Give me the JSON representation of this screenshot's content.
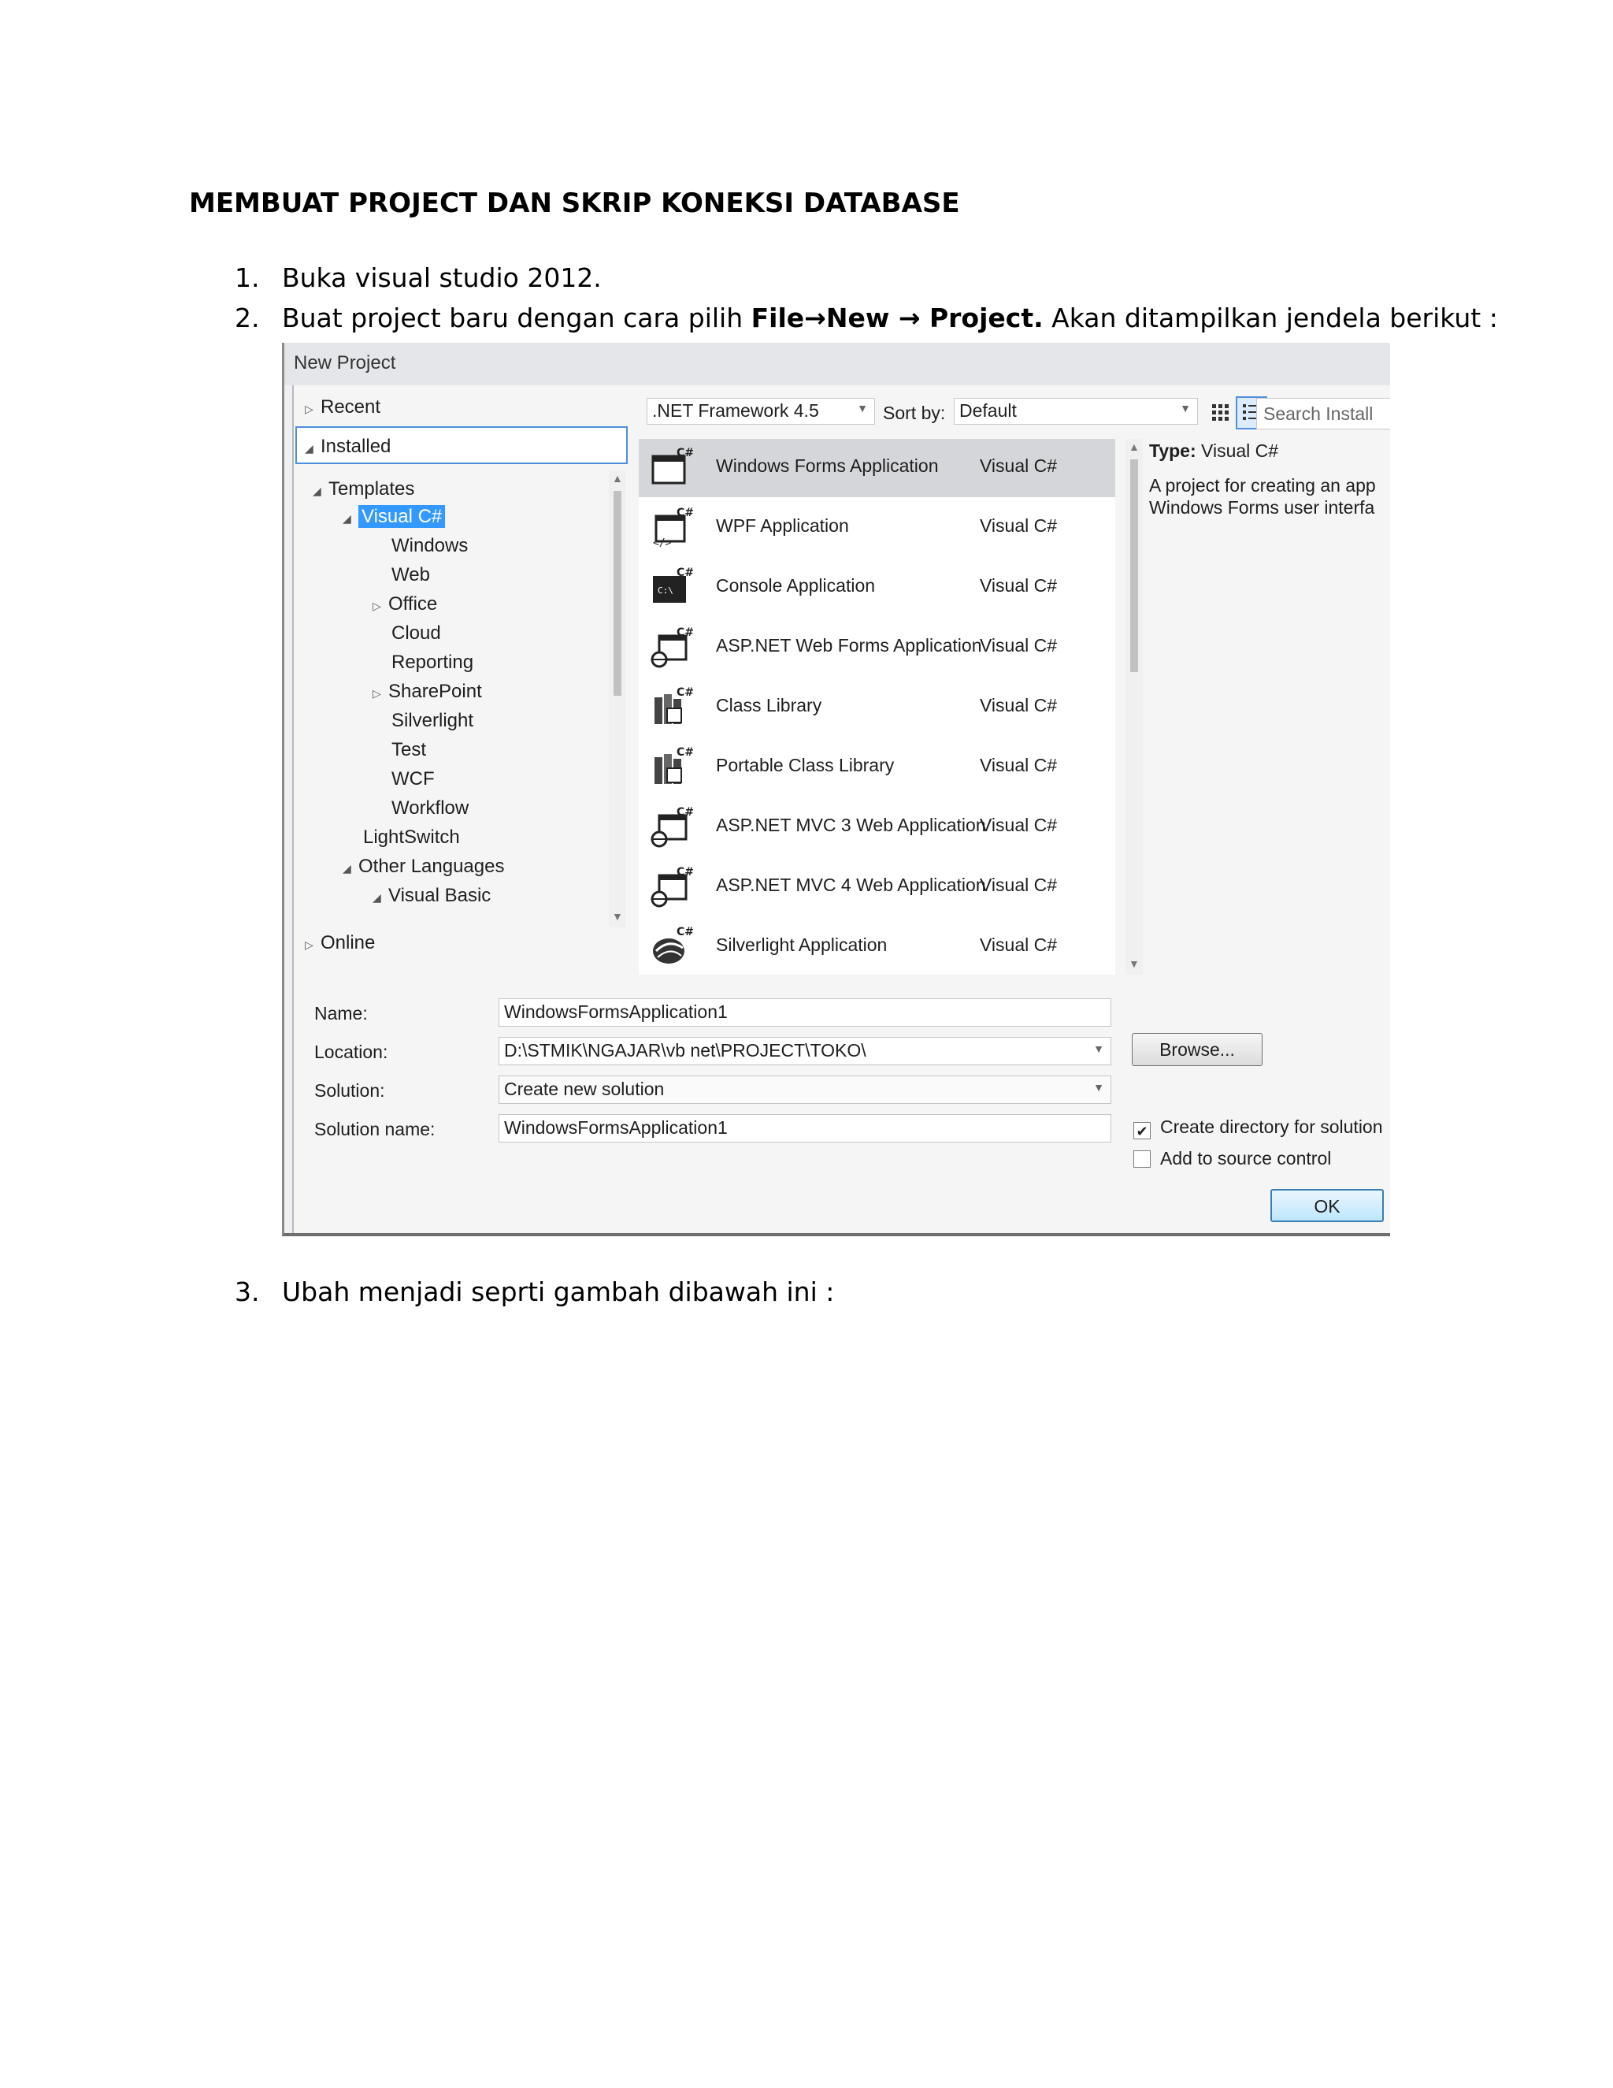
{
  "document": {
    "title": "MEMBUAT PROJECT DAN SKRIP KONEKSI DATABASE",
    "steps": [
      {
        "num": "1.",
        "text": "Buka visual studio 2012."
      },
      {
        "num": "2.",
        "pre": "Buat project baru dengan cara pilih ",
        "b1": "File",
        "arrow1": "→",
        "b2": "New",
        "arrow2": " → ",
        "b3": "Project.",
        "post": " Akan ditampilkan jendela berikut :"
      },
      {
        "num": "3.",
        "text": "Ubah menjadi seprti gambah dibawah ini :"
      }
    ]
  },
  "dialog": {
    "title": "New Project",
    "nav": {
      "recent": "Recent",
      "installed": "Installed",
      "templates": "Templates",
      "visual_csharp": "Visual C#",
      "children": [
        "Windows",
        "Web",
        "Office",
        "Cloud",
        "Reporting",
        "SharePoint",
        "Silverlight",
        "Test",
        "WCF",
        "Workflow"
      ],
      "lightswitch": "LightSwitch",
      "other_languages": "Other Languages",
      "visual_basic": "Visual Basic",
      "online": "Online"
    },
    "toolbar": {
      "framework": ".NET Framework 4.5",
      "sort_label": "Sort by:",
      "sort_value": "Default",
      "search_placeholder": "Search Install"
    },
    "templates": [
      {
        "name": "Windows Forms Application",
        "lang": "Visual C#"
      },
      {
        "name": "WPF Application",
        "lang": "Visual C#"
      },
      {
        "name": "Console Application",
        "lang": "Visual C#"
      },
      {
        "name": "ASP.NET Web Forms Application",
        "lang": "Visual C#"
      },
      {
        "name": "Class Library",
        "lang": "Visual C#"
      },
      {
        "name": "Portable Class Library",
        "lang": "Visual C#"
      },
      {
        "name": "ASP.NET MVC 3 Web Application",
        "lang": "Visual C#"
      },
      {
        "name": "ASP.NET MVC 4 Web Application",
        "lang": "Visual C#"
      },
      {
        "name": "Silverlight Application",
        "lang": "Visual C#"
      }
    ],
    "details": {
      "type_label": "Type:",
      "type_value": "Visual C#",
      "desc_line1": "A project for creating an app",
      "desc_line2": "Windows Forms user interfa"
    },
    "form": {
      "name_label": "Name:",
      "name_value": "WindowsFormsApplication1",
      "location_label": "Location:",
      "location_value": "D:\\STMIK\\NGAJAR\\vb net\\PROJECT\\TOKO\\",
      "solution_label": "Solution:",
      "solution_value": "Create new solution",
      "solution_name_label": "Solution name:",
      "solution_name_value": "WindowsFormsApplication1",
      "browse": "Browse...",
      "create_dir": "Create directory for solution",
      "add_source": "Add to source control",
      "ok": "OK"
    },
    "colors": {
      "selection": "#3399ff",
      "active_row": "#d5d6da",
      "ok_border": "#3c7fb1"
    }
  }
}
